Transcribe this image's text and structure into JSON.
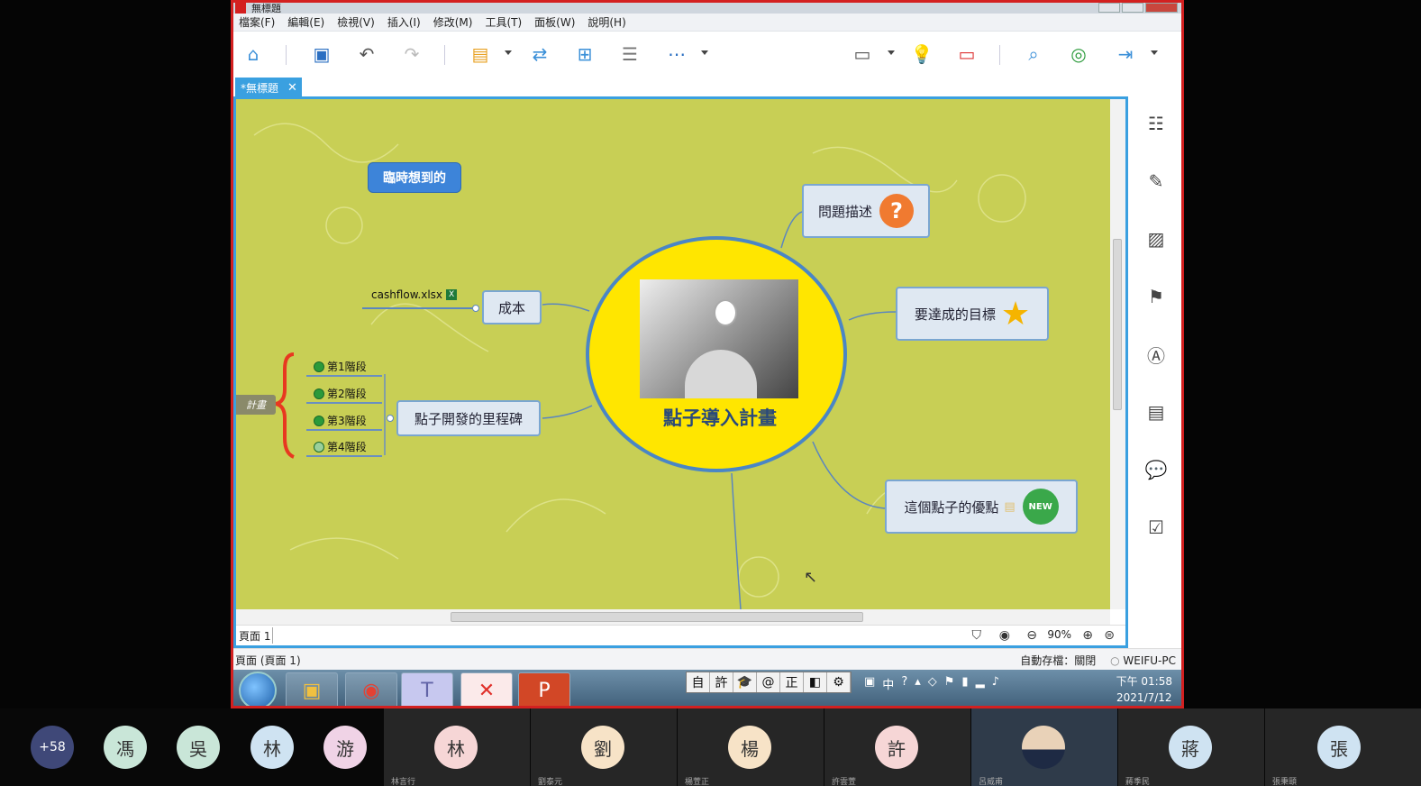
{
  "window": {
    "title": "無標題",
    "doc_tab": "*無標題",
    "menu": [
      "檔案(F)",
      "編輯(E)",
      "檢視(V)",
      "插入(I)",
      "修改(M)",
      "工具(T)",
      "面板(W)",
      "說明(H)"
    ]
  },
  "mindmap": {
    "central": "點子導入計畫",
    "floating": "臨時想到的",
    "nodes": {
      "problem": "問題描述",
      "goal": "要達成的目標",
      "advantage": "這個點子的優點",
      "cost": "成本",
      "milestone": "點子開發的里程碑"
    },
    "file_link": "cashflow.xlsx",
    "stages": [
      "第1階段",
      "第2階段",
      "第3階段",
      "第4階段"
    ],
    "boundary_label": "計畫"
  },
  "status": {
    "page_tab": "頁面 1",
    "zoom": "90%",
    "bottom_left": "頁面 (頁面 1)",
    "autosave": "自動存檔：關閉",
    "machine": "WEIFU-PC"
  },
  "taskbar": {
    "ime": [
      "自",
      "許",
      "🎓",
      "@",
      "正",
      "◧",
      "⚙"
    ],
    "time": "下午 01:58",
    "date": "2021/7/12"
  },
  "participants": {
    "overflow": "+58",
    "people": [
      {
        "initial": "馮",
        "color": "#c9e6d8",
        "name": ""
      },
      {
        "initial": "吳",
        "color": "#c9e6d8",
        "name": ""
      },
      {
        "initial": "林",
        "color": "#cfe3f2",
        "name": ""
      },
      {
        "initial": "游",
        "color": "#f0d3e6",
        "name": ""
      },
      {
        "initial": "林",
        "color": "#f6d6d6",
        "name": "林言行"
      },
      {
        "initial": "劉",
        "color": "#f7e3c7",
        "name": "劉泰元"
      },
      {
        "initial": "楊",
        "color": "#f7e3c7",
        "name": "楊萱正"
      },
      {
        "initial": "許",
        "color": "#f6d6d6",
        "name": "許雲萱"
      },
      {
        "initial": "",
        "color": "#ddd",
        "name": "呂威甫"
      },
      {
        "initial": "蔣",
        "color": "#cfe3f2",
        "name": "蔣季民"
      },
      {
        "initial": "張",
        "color": "#cfe3f2",
        "name": "張秉頤"
      }
    ]
  },
  "colors": {
    "accent": "#3aa0e0",
    "canvas_bg": "#c8cf55",
    "central_fill": "#ffe600",
    "share_border": "#d32020"
  }
}
